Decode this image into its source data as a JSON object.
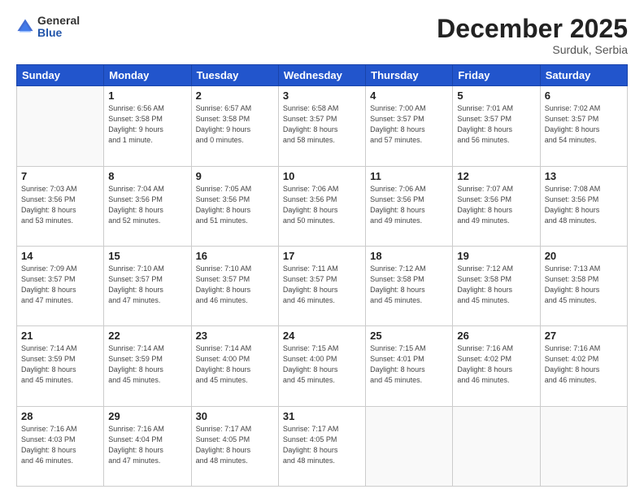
{
  "logo": {
    "general": "General",
    "blue": "Blue"
  },
  "header": {
    "month": "December 2025",
    "location": "Surduk, Serbia"
  },
  "weekdays": [
    "Sunday",
    "Monday",
    "Tuesday",
    "Wednesday",
    "Thursday",
    "Friday",
    "Saturday"
  ],
  "weeks": [
    [
      {
        "day": "",
        "info": ""
      },
      {
        "day": "1",
        "info": "Sunrise: 6:56 AM\nSunset: 3:58 PM\nDaylight: 9 hours\nand 1 minute."
      },
      {
        "day": "2",
        "info": "Sunrise: 6:57 AM\nSunset: 3:58 PM\nDaylight: 9 hours\nand 0 minutes."
      },
      {
        "day": "3",
        "info": "Sunrise: 6:58 AM\nSunset: 3:57 PM\nDaylight: 8 hours\nand 58 minutes."
      },
      {
        "day": "4",
        "info": "Sunrise: 7:00 AM\nSunset: 3:57 PM\nDaylight: 8 hours\nand 57 minutes."
      },
      {
        "day": "5",
        "info": "Sunrise: 7:01 AM\nSunset: 3:57 PM\nDaylight: 8 hours\nand 56 minutes."
      },
      {
        "day": "6",
        "info": "Sunrise: 7:02 AM\nSunset: 3:57 PM\nDaylight: 8 hours\nand 54 minutes."
      }
    ],
    [
      {
        "day": "7",
        "info": "Sunrise: 7:03 AM\nSunset: 3:56 PM\nDaylight: 8 hours\nand 53 minutes."
      },
      {
        "day": "8",
        "info": "Sunrise: 7:04 AM\nSunset: 3:56 PM\nDaylight: 8 hours\nand 52 minutes."
      },
      {
        "day": "9",
        "info": "Sunrise: 7:05 AM\nSunset: 3:56 PM\nDaylight: 8 hours\nand 51 minutes."
      },
      {
        "day": "10",
        "info": "Sunrise: 7:06 AM\nSunset: 3:56 PM\nDaylight: 8 hours\nand 50 minutes."
      },
      {
        "day": "11",
        "info": "Sunrise: 7:06 AM\nSunset: 3:56 PM\nDaylight: 8 hours\nand 49 minutes."
      },
      {
        "day": "12",
        "info": "Sunrise: 7:07 AM\nSunset: 3:56 PM\nDaylight: 8 hours\nand 49 minutes."
      },
      {
        "day": "13",
        "info": "Sunrise: 7:08 AM\nSunset: 3:56 PM\nDaylight: 8 hours\nand 48 minutes."
      }
    ],
    [
      {
        "day": "14",
        "info": "Sunrise: 7:09 AM\nSunset: 3:57 PM\nDaylight: 8 hours\nand 47 minutes."
      },
      {
        "day": "15",
        "info": "Sunrise: 7:10 AM\nSunset: 3:57 PM\nDaylight: 8 hours\nand 47 minutes."
      },
      {
        "day": "16",
        "info": "Sunrise: 7:10 AM\nSunset: 3:57 PM\nDaylight: 8 hours\nand 46 minutes."
      },
      {
        "day": "17",
        "info": "Sunrise: 7:11 AM\nSunset: 3:57 PM\nDaylight: 8 hours\nand 46 minutes."
      },
      {
        "day": "18",
        "info": "Sunrise: 7:12 AM\nSunset: 3:58 PM\nDaylight: 8 hours\nand 45 minutes."
      },
      {
        "day": "19",
        "info": "Sunrise: 7:12 AM\nSunset: 3:58 PM\nDaylight: 8 hours\nand 45 minutes."
      },
      {
        "day": "20",
        "info": "Sunrise: 7:13 AM\nSunset: 3:58 PM\nDaylight: 8 hours\nand 45 minutes."
      }
    ],
    [
      {
        "day": "21",
        "info": "Sunrise: 7:14 AM\nSunset: 3:59 PM\nDaylight: 8 hours\nand 45 minutes."
      },
      {
        "day": "22",
        "info": "Sunrise: 7:14 AM\nSunset: 3:59 PM\nDaylight: 8 hours\nand 45 minutes."
      },
      {
        "day": "23",
        "info": "Sunrise: 7:14 AM\nSunset: 4:00 PM\nDaylight: 8 hours\nand 45 minutes."
      },
      {
        "day": "24",
        "info": "Sunrise: 7:15 AM\nSunset: 4:00 PM\nDaylight: 8 hours\nand 45 minutes."
      },
      {
        "day": "25",
        "info": "Sunrise: 7:15 AM\nSunset: 4:01 PM\nDaylight: 8 hours\nand 45 minutes."
      },
      {
        "day": "26",
        "info": "Sunrise: 7:16 AM\nSunset: 4:02 PM\nDaylight: 8 hours\nand 46 minutes."
      },
      {
        "day": "27",
        "info": "Sunrise: 7:16 AM\nSunset: 4:02 PM\nDaylight: 8 hours\nand 46 minutes."
      }
    ],
    [
      {
        "day": "28",
        "info": "Sunrise: 7:16 AM\nSunset: 4:03 PM\nDaylight: 8 hours\nand 46 minutes."
      },
      {
        "day": "29",
        "info": "Sunrise: 7:16 AM\nSunset: 4:04 PM\nDaylight: 8 hours\nand 47 minutes."
      },
      {
        "day": "30",
        "info": "Sunrise: 7:17 AM\nSunset: 4:05 PM\nDaylight: 8 hours\nand 48 minutes."
      },
      {
        "day": "31",
        "info": "Sunrise: 7:17 AM\nSunset: 4:05 PM\nDaylight: 8 hours\nand 48 minutes."
      },
      {
        "day": "",
        "info": ""
      },
      {
        "day": "",
        "info": ""
      },
      {
        "day": "",
        "info": ""
      }
    ]
  ]
}
